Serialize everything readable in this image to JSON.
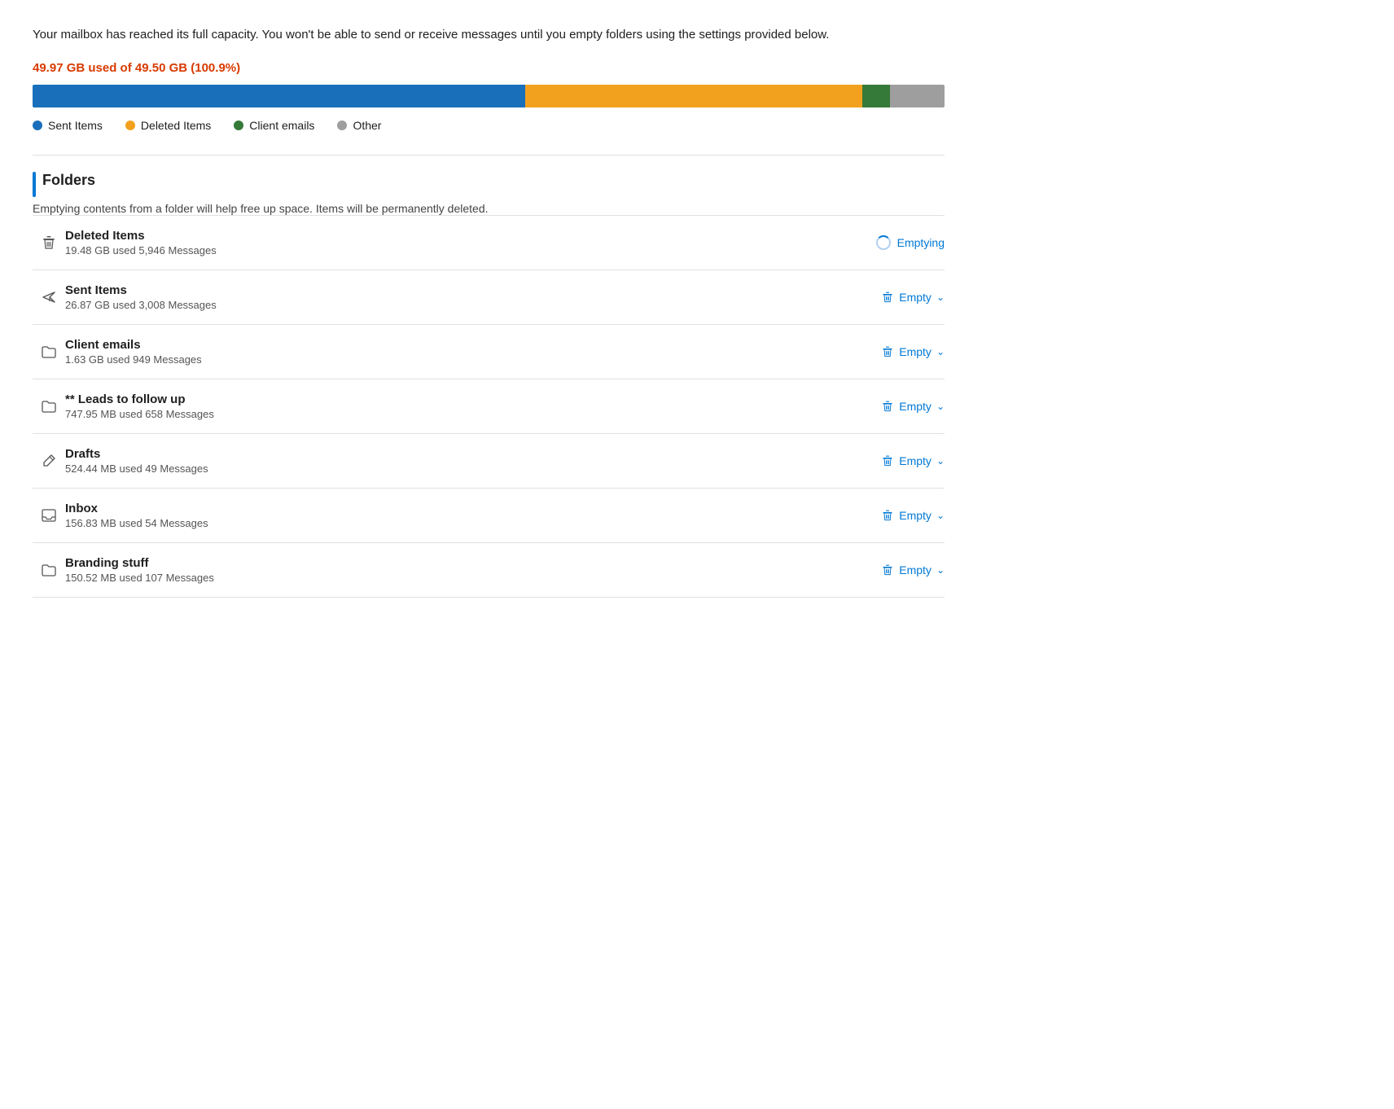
{
  "warning": {
    "text": "Your mailbox has reached its full capacity. You won't be able to send or receive messages until you empty folders using the settings provided below."
  },
  "usage": {
    "label": "49.97 GB used of 49.50 GB (100.9%)",
    "used_prefix": "49.97 GB used of 49.50 GB (",
    "bold_part": "100.9%",
    "used_suffix": ")"
  },
  "bar_segments": [
    {
      "color": "#1a6fbb",
      "width": "54%"
    },
    {
      "color": "#f2a11e",
      "width": "37%"
    },
    {
      "color": "#357a38",
      "width": "3%"
    },
    {
      "color": "#9e9e9e",
      "width": "6%"
    }
  ],
  "legend": [
    {
      "label": "Sent Items",
      "color": "#1a6fbb"
    },
    {
      "label": "Deleted Items",
      "color": "#f2a11e"
    },
    {
      "label": "Client emails",
      "color": "#357a38"
    },
    {
      "label": "Other",
      "color": "#9e9e9e"
    }
  ],
  "folders_heading": "Folders",
  "folders_subtext": "Emptying contents from a folder will help free up space. Items will be permanently deleted.",
  "folders": [
    {
      "name": "Deleted Items",
      "meta": "19.48 GB used  5,946 Messages",
      "icon": "trash",
      "action": "emptying",
      "action_label": "Emptying"
    },
    {
      "name": "Sent Items",
      "meta": "26.87 GB used  3,008 Messages",
      "icon": "send",
      "action": "empty",
      "action_label": "Empty"
    },
    {
      "name": "Client emails",
      "meta": "1.63 GB used  949 Messages",
      "icon": "folder",
      "action": "empty",
      "action_label": "Empty"
    },
    {
      "name": "** Leads to follow up",
      "meta": "747.95 MB used  658 Messages",
      "icon": "folder",
      "action": "empty",
      "action_label": "Empty"
    },
    {
      "name": "Drafts",
      "meta": "524.44 MB used  49 Messages",
      "icon": "pencil",
      "action": "empty",
      "action_label": "Empty"
    },
    {
      "name": "Inbox",
      "meta": "156.83 MB used  54 Messages",
      "icon": "inbox",
      "action": "empty",
      "action_label": "Empty"
    },
    {
      "name": "Branding stuff",
      "meta": "150.52 MB used  107 Messages",
      "icon": "folder",
      "action": "empty",
      "action_label": "Empty"
    }
  ]
}
